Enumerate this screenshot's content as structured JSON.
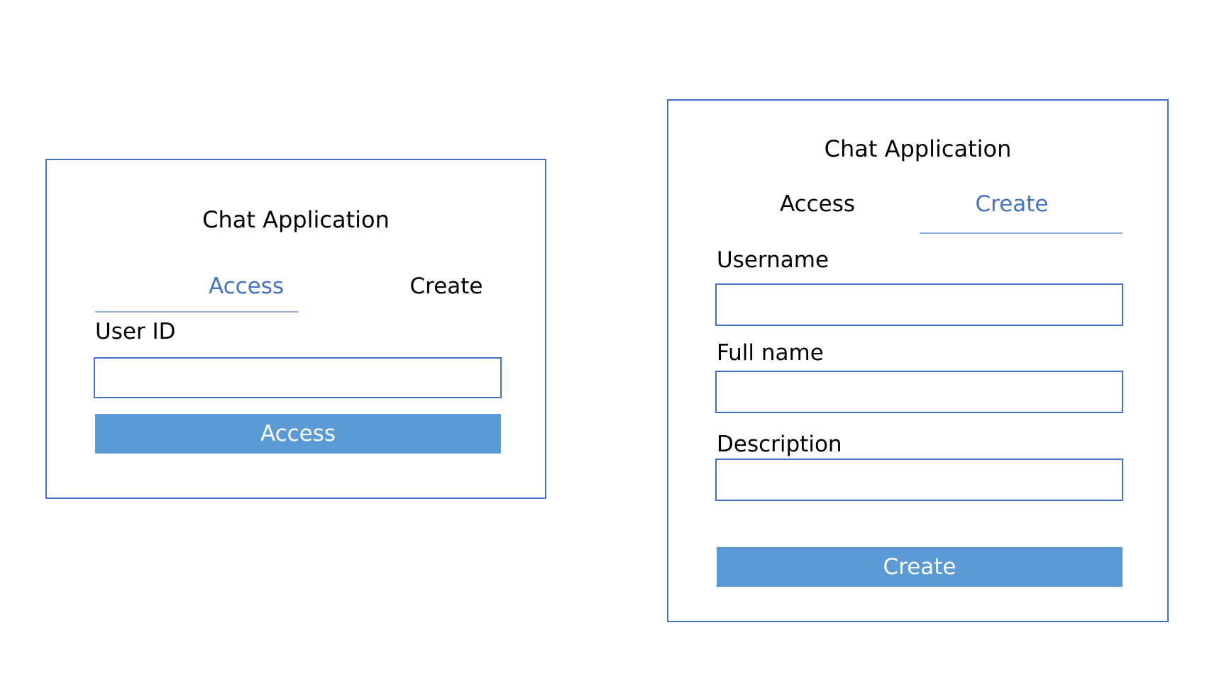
{
  "access_panel": {
    "title": "Chat Application",
    "tabs": [
      {
        "label": "Access",
        "active": true
      },
      {
        "label": "Create",
        "active": false
      }
    ],
    "fields": [
      {
        "label": "User ID",
        "value": "",
        "placeholder": ""
      }
    ],
    "submit_label": "Access"
  },
  "create_panel": {
    "title": "Chat Application",
    "tabs": [
      {
        "label": "Access",
        "active": false
      },
      {
        "label": "Create",
        "active": true
      }
    ],
    "fields": [
      {
        "label": "Username",
        "value": "",
        "placeholder": ""
      },
      {
        "label": "Full name",
        "value": "",
        "placeholder": ""
      },
      {
        "label": "Description",
        "value": "",
        "placeholder": ""
      }
    ],
    "submit_label": "Create"
  },
  "colors": {
    "accent": "#4472c4",
    "button": "#5b9bd5",
    "tab_underline": "#8faadc"
  }
}
